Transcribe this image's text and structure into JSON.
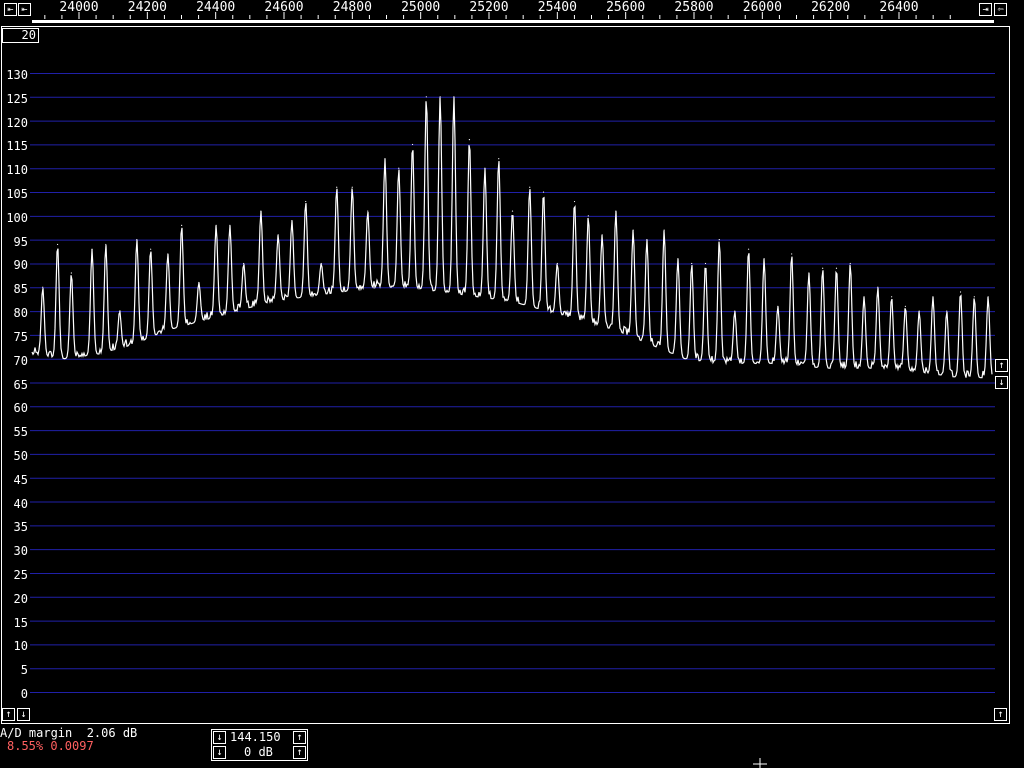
{
  "frequency_axis": {
    "labels": [
      "24000",
      "24200",
      "24400",
      "24600",
      "24800",
      "25000",
      "25200",
      "25400",
      "25600",
      "25800",
      "26000",
      "26200",
      "26400"
    ],
    "values": [
      24000,
      24200,
      24400,
      24600,
      24800,
      25000,
      25200,
      25400,
      25600,
      25800,
      26000,
      26200,
      26400
    ]
  },
  "y_axis": {
    "labels": [
      "130",
      "125",
      "120",
      "115",
      "110",
      "105",
      "100",
      "95",
      "90",
      "85",
      "80",
      "75",
      "70",
      "65",
      "60",
      "55",
      "50",
      "45",
      "40",
      "35",
      "30",
      "25",
      "20",
      "15",
      "10",
      "5",
      "0"
    ],
    "min": 0,
    "max": 130
  },
  "averages_count": "20",
  "buttons": {
    "scroll_left": "⇤",
    "scroll_right": "⇥",
    "zoom_in": "⇤",
    "zoom_out": "⇦",
    "level_up": "↑",
    "level_down": "↓",
    "gain_up": "↑",
    "gain_down": "↓",
    "bottom_up": "↑",
    "bottom_down": "↓",
    "bottom_right": "↑"
  },
  "status": {
    "ad_margin": "A/D margin  2.06 dB",
    "ratio": "8.55% 0.0097"
  },
  "tuning": {
    "frequency": "144.150",
    "gain": "0 dB"
  },
  "colors": {
    "background": "#000000",
    "grid": "#2020a8",
    "trace": "#ffffff",
    "ratio_text": "#ff6060"
  },
  "chart_data": {
    "type": "line",
    "xlim": [
      23900,
      26700
    ],
    "ylim": [
      0,
      130
    ],
    "grid": true,
    "baseline": [
      [
        23900,
        71
      ],
      [
        24000,
        70
      ],
      [
        24100,
        71
      ],
      [
        24200,
        73
      ],
      [
        24300,
        76
      ],
      [
        24400,
        78
      ],
      [
        24500,
        80
      ],
      [
        24600,
        82
      ],
      [
        24700,
        83
      ],
      [
        24800,
        84
      ],
      [
        24900,
        85
      ],
      [
        25000,
        85
      ],
      [
        25100,
        84
      ],
      [
        25200,
        83
      ],
      [
        25300,
        82
      ],
      [
        25400,
        80
      ],
      [
        25500,
        78
      ],
      [
        25600,
        76
      ],
      [
        25700,
        73
      ],
      [
        25800,
        70
      ],
      [
        25900,
        69
      ],
      [
        26000,
        69
      ],
      [
        26100,
        69
      ],
      [
        26200,
        68
      ],
      [
        26300,
        68
      ],
      [
        26400,
        68
      ],
      [
        26500,
        67
      ],
      [
        26600,
        66
      ],
      [
        26700,
        66
      ]
    ],
    "peaks": [
      {
        "x": 23937,
        "y": 85
      },
      {
        "x": 23980,
        "y": 94
      },
      {
        "x": 24020,
        "y": 88
      },
      {
        "x": 24080,
        "y": 93
      },
      {
        "x": 24120,
        "y": 94
      },
      {
        "x": 24160,
        "y": 80
      },
      {
        "x": 24210,
        "y": 95
      },
      {
        "x": 24250,
        "y": 93
      },
      {
        "x": 24300,
        "y": 92
      },
      {
        "x": 24340,
        "y": 98
      },
      {
        "x": 24390,
        "y": 86
      },
      {
        "x": 24440,
        "y": 98
      },
      {
        "x": 24480,
        "y": 98
      },
      {
        "x": 24520,
        "y": 90
      },
      {
        "x": 24570,
        "y": 101
      },
      {
        "x": 24620,
        "y": 96
      },
      {
        "x": 24660,
        "y": 99
      },
      {
        "x": 24700,
        "y": 103
      },
      {
        "x": 24745,
        "y": 90
      },
      {
        "x": 24790,
        "y": 106
      },
      {
        "x": 24835,
        "y": 106
      },
      {
        "x": 24880,
        "y": 101
      },
      {
        "x": 24930,
        "y": 112
      },
      {
        "x": 24970,
        "y": 110
      },
      {
        "x": 25010,
        "y": 115
      },
      {
        "x": 25050,
        "y": 125
      },
      {
        "x": 25090,
        "y": 125
      },
      {
        "x": 25130,
        "y": 125
      },
      {
        "x": 25175,
        "y": 116
      },
      {
        "x": 25220,
        "y": 110
      },
      {
        "x": 25260,
        "y": 112
      },
      {
        "x": 25300,
        "y": 101
      },
      {
        "x": 25350,
        "y": 106
      },
      {
        "x": 25390,
        "y": 105
      },
      {
        "x": 25430,
        "y": 90
      },
      {
        "x": 25480,
        "y": 103
      },
      {
        "x": 25520,
        "y": 100
      },
      {
        "x": 25560,
        "y": 96
      },
      {
        "x": 25600,
        "y": 101
      },
      {
        "x": 25650,
        "y": 97
      },
      {
        "x": 25690,
        "y": 95
      },
      {
        "x": 25740,
        "y": 97
      },
      {
        "x": 25780,
        "y": 91
      },
      {
        "x": 25820,
        "y": 90
      },
      {
        "x": 25860,
        "y": 90
      },
      {
        "x": 25900,
        "y": 95
      },
      {
        "x": 25945,
        "y": 80
      },
      {
        "x": 25985,
        "y": 93
      },
      {
        "x": 26030,
        "y": 91
      },
      {
        "x": 26070,
        "y": 81
      },
      {
        "x": 26110,
        "y": 92
      },
      {
        "x": 26160,
        "y": 88
      },
      {
        "x": 26200,
        "y": 89
      },
      {
        "x": 26240,
        "y": 89
      },
      {
        "x": 26280,
        "y": 90
      },
      {
        "x": 26320,
        "y": 83
      },
      {
        "x": 26360,
        "y": 85
      },
      {
        "x": 26400,
        "y": 83
      },
      {
        "x": 26440,
        "y": 81
      },
      {
        "x": 26480,
        "y": 80
      },
      {
        "x": 26520,
        "y": 83
      },
      {
        "x": 26560,
        "y": 80
      },
      {
        "x": 26600,
        "y": 84
      },
      {
        "x": 26640,
        "y": 83
      },
      {
        "x": 26680,
        "y": 83
      }
    ]
  }
}
